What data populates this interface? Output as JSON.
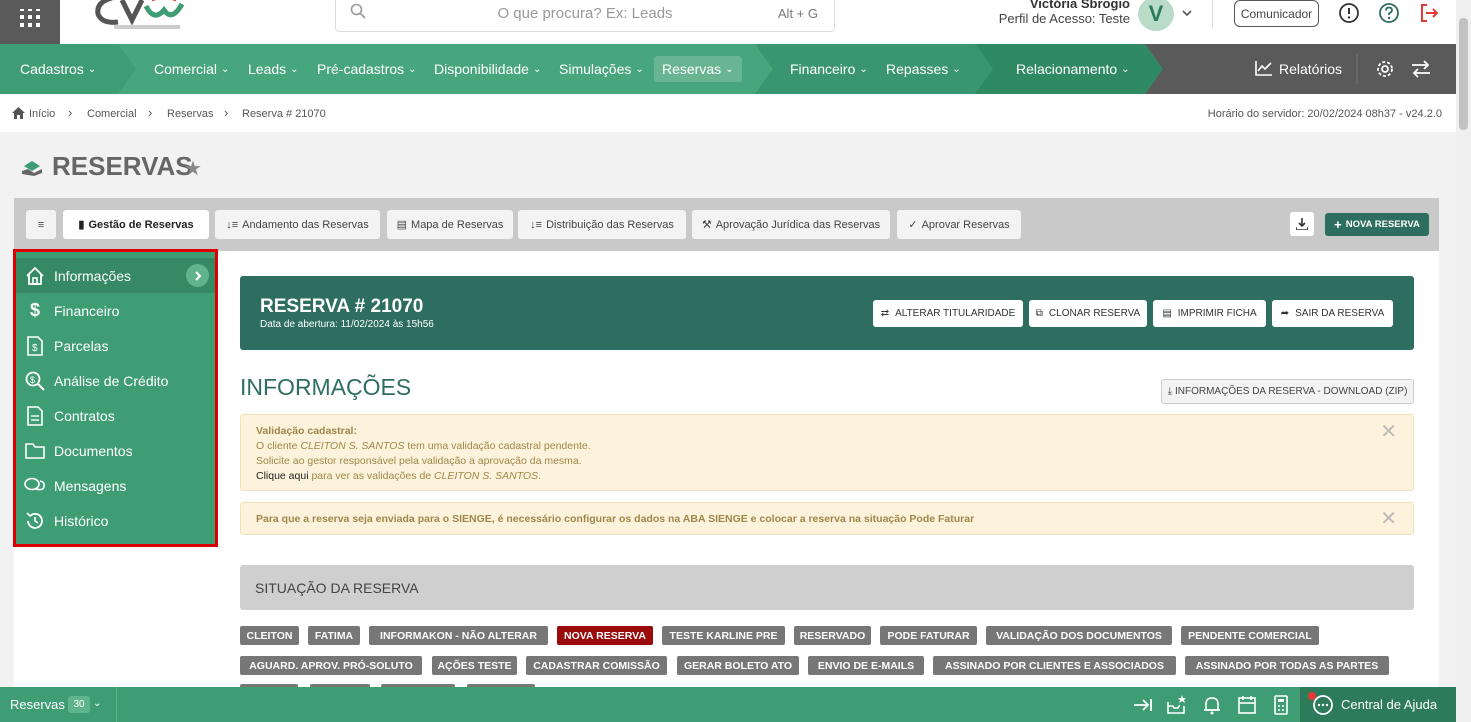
{
  "header": {
    "search_placeholder": "O que procura? Ex: Leads",
    "search_shortcut": "Alt + G",
    "user_name": "Victória Sbrogio",
    "user_profile": "Perfil de Acesso: Teste",
    "avatar_letter": "V",
    "comunicador": "Comunicador"
  },
  "nav": {
    "items": [
      {
        "label": "Cadastros"
      },
      {
        "label": "Comercial"
      },
      {
        "label": "Leads"
      },
      {
        "label": "Pré-cadastros"
      },
      {
        "label": "Disponibilidade"
      },
      {
        "label": "Simulações"
      },
      {
        "label": "Reservas"
      },
      {
        "label": "Financeiro"
      },
      {
        "label": "Repasses"
      },
      {
        "label": "Relacionamento"
      }
    ],
    "relatorios": "Relatórios",
    "colors": {
      "base": "#3f9d73",
      "dark": "#2e7b5c",
      "gray": "#5a5a5a"
    }
  },
  "breadcrumb": {
    "items": [
      "Início",
      "Comercial",
      "Reservas",
      "Reserva # 21070"
    ],
    "server_time": "Horário do servidor: 20/02/2024 08h37 - v24.2.0"
  },
  "page": {
    "title": "RESERVAS"
  },
  "tabs": [
    {
      "label": "Gestão de Reservas"
    },
    {
      "label": "Andamento das Reservas"
    },
    {
      "label": "Mapa de Reservas"
    },
    {
      "label": "Distribuição das Reservas"
    },
    {
      "label": "Aprovação Jurídica das Reservas"
    },
    {
      "label": "Aprovar Reservas"
    }
  ],
  "nova_reserva": "NOVA RESERVA",
  "sidemenu": {
    "items": [
      {
        "label": "Informações",
        "icon": "home-icon"
      },
      {
        "label": "Financeiro",
        "icon": "dollar-icon"
      },
      {
        "label": "Parcelas",
        "icon": "invoice-icon"
      },
      {
        "label": "Análise de Crédito",
        "icon": "search-dollar-icon"
      },
      {
        "label": "Contratos",
        "icon": "document-icon"
      },
      {
        "label": "Documentos",
        "icon": "folder-icon"
      },
      {
        "label": "Mensagens",
        "icon": "chat-icon"
      },
      {
        "label": "Histórico",
        "icon": "history-icon"
      }
    ]
  },
  "reserva": {
    "title": "RESERVA # 21070",
    "opened": "Data de abertura: 11/02/2024 às 15h56",
    "buttons": [
      "ALTERAR TITULARIDADE",
      "CLONAR RESERVA",
      "IMPRIMIR FICHA",
      "SAIR DA RESERVA"
    ]
  },
  "info": {
    "title": "INFORMAÇÕES",
    "download": "INFORMAÇÕES DA RESERVA - DOWNLOAD (ZIP)"
  },
  "alerts": {
    "validation": {
      "title": "Validação cadastral:",
      "line1_pre": "O cliente ",
      "client": "CLEITON S. SANTOS",
      "line1_post": " tem uma validação cadastral pendente.",
      "line2": "Solicite ao gestor responsável pela validação a aprovação da mesma.",
      "link": "Clique aqui",
      "line3_pre": " para ver as validações de ",
      "line3_post": "."
    },
    "sienge": "Para que a reserva seja enviada para o SIENGE, é necessário configurar os dados na ABA SIENGE e colocar a reserva na situação Pode Faturar"
  },
  "situacao": {
    "title": "SITUAÇÃO DA RESERVA",
    "chips": [
      "CLEITON",
      "FATIMA",
      "INFORMAKON - NÃO ALTERAR",
      "NOVA RESERVA",
      "TESTE KARLINE PRE",
      "RESERVADO",
      "PODE FATURAR",
      "VALIDAÇÃO DOS DOCUMENTOS",
      "PENDENTE COMERCIAL",
      "AGUARD. APROV. PRÓ-SOLUTO",
      "AÇÕES TESTE",
      "CADASTRAR COMISSÃO",
      "GERAR BOLETO ATO",
      "ENVIO DE E-MAILS",
      "ASSINADO POR CLIENTES E ASSOCIADOS",
      "ASSINADO POR TODAS AS PARTES"
    ],
    "selected": "NOVA RESERVA"
  },
  "bottom": {
    "label": "Reservas",
    "count": "30",
    "help": "Central de Ajuda"
  }
}
